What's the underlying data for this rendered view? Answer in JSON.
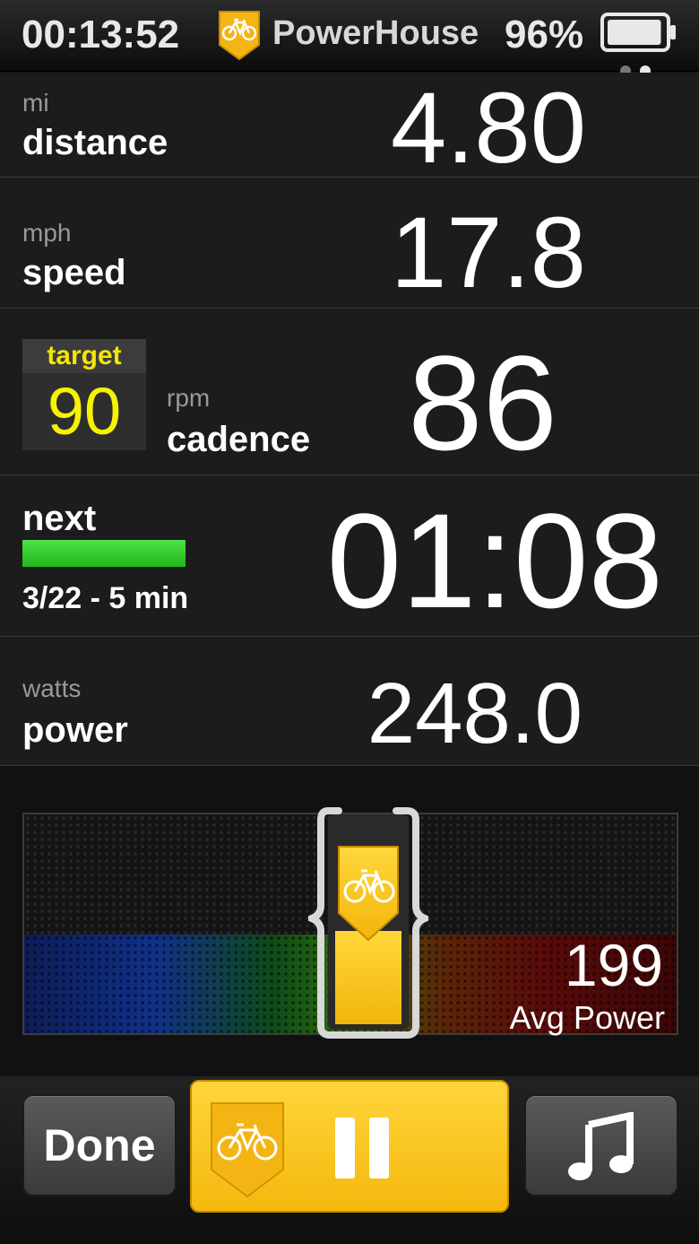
{
  "status_bar": {
    "time": "00:13:52",
    "app_name": "PowerHouse",
    "battery_percent": "96%",
    "battery_level": 0.96,
    "page_count": 2,
    "active_page": 2
  },
  "metrics": {
    "distance": {
      "unit": "mi",
      "label": "distance",
      "value": "4.80"
    },
    "speed": {
      "unit": "mph",
      "label": "speed",
      "value": "17.8"
    },
    "cadence": {
      "target_label": "target",
      "target_value": "90",
      "unit": "rpm",
      "label": "cadence",
      "value": "86"
    },
    "interval": {
      "label": "next",
      "progress": "3/22 - 5 min",
      "value": "01:08"
    },
    "power": {
      "unit": "watts",
      "label": "power",
      "value": "248.0"
    }
  },
  "gauge": {
    "avg_value": "199",
    "avg_label": "Avg Power"
  },
  "toolbar": {
    "done_label": "Done"
  },
  "icons": {
    "app_logo": "bicycle-badge-icon",
    "pause": "pause-icon",
    "music": "music-note-icon"
  },
  "colors": {
    "accent_yellow": "#f7c21c",
    "target_yellow": "#f7f300",
    "progress_green": "#2fc62a"
  }
}
